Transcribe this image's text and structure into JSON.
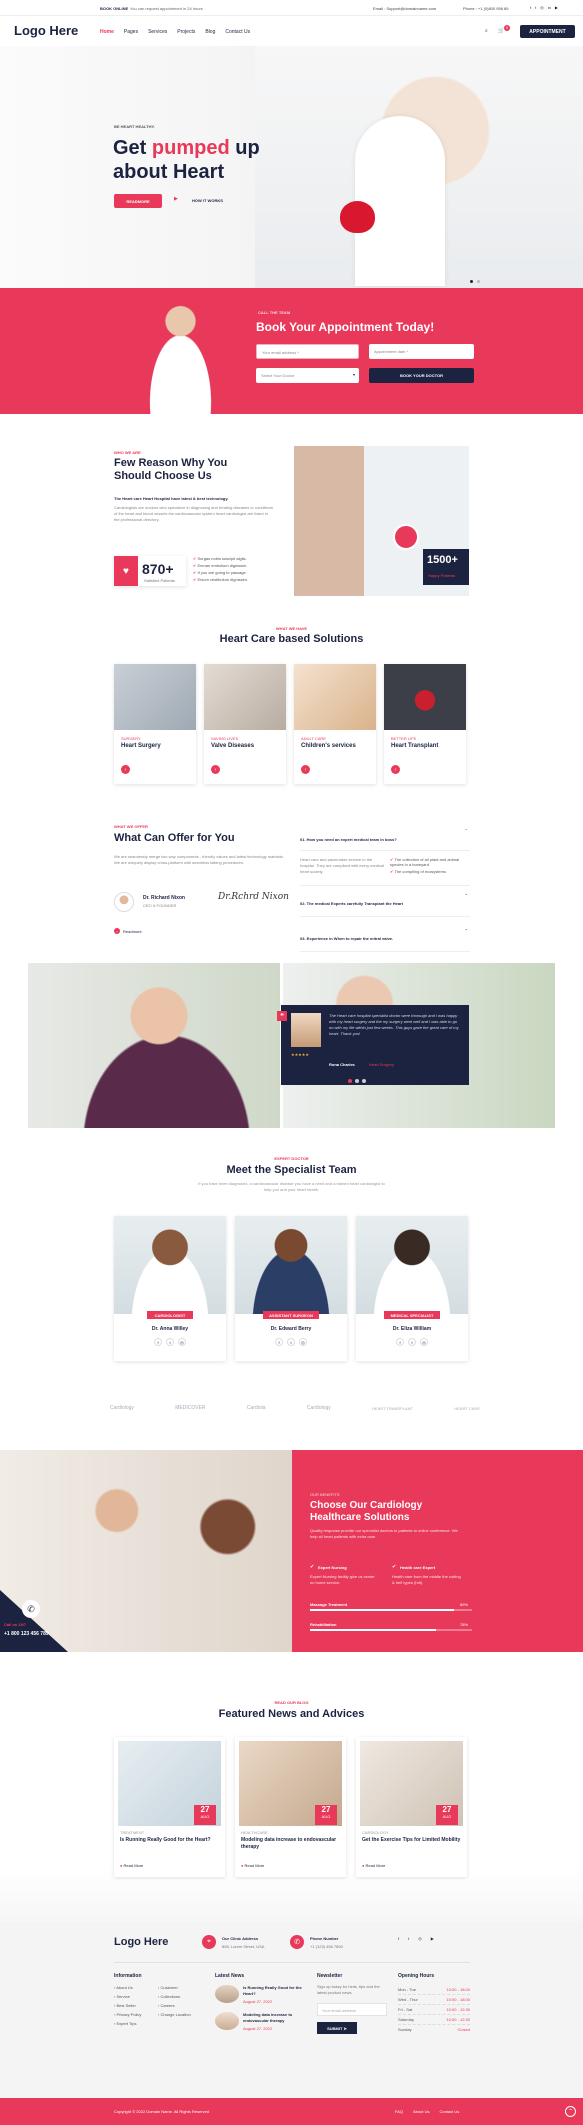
{
  "topbar": {
    "book": "BOOK ONLINE",
    "book_sub": "You can request appointment in 24 hours",
    "email": "Email : Support@domainname.com",
    "phone": "Phone : +1 (0)800 956 89"
  },
  "header": {
    "logo": "Logo Here",
    "nav": [
      "Home",
      "Pages",
      "Services",
      "Projects",
      "Blog",
      "Contact Us"
    ],
    "cart_count": "0",
    "appointment": "APPOINTMENT"
  },
  "hero": {
    "eyebrow": "BE HEART HEALTHY.",
    "title_a": "Get ",
    "title_b": "pumped",
    "title_c": " up",
    "title_d": "about Heart",
    "btn": "READMORE",
    "link": "HOW IT WORKS"
  },
  "booking": {
    "eyebrow": "CALL THE TEAM",
    "title": "Book Your Appointment Today!",
    "email_ph": "Your email address *",
    "date_ph": "Appointment date *",
    "doctor_ph": "Select Your Doctor",
    "btn": "BOOK YOUR DOCTOR"
  },
  "reason": {
    "eyebrow": "WHO WE ARE",
    "title": "Few Reason Why You Should Choose Us",
    "lead": "The Heart care Heart Hospital have latest & best technology.",
    "body": "Cardiologists are doctors who specialize in diagnosing and treating diseases or conditions of the heart and blood vessels the cardiovascular system heart cardiologist are listed in the professional directory.",
    "stat1": "870+",
    "stat1_label": "Satisfied Patients",
    "checks": [
      "Surgas nobis suscipit alglis.",
      "Enman embolium dignissim.",
      "If you are going to passage.",
      "Enium vestibulum dignissim."
    ],
    "stat2": "1500+",
    "stat2_label": "Happy Patients"
  },
  "solutions": {
    "eyebrow": "WHAT WE HAVE",
    "title": "Heart Care based Solutions",
    "items": [
      {
        "tag": "SURGERY",
        "name": "Heart Surgery"
      },
      {
        "tag": "SAVING LIVES",
        "name": "Valve Diseases"
      },
      {
        "tag": "ADULT CARE",
        "name": "Children's services"
      },
      {
        "tag": "BETTER LIFE",
        "name": "Heart Transplant"
      }
    ]
  },
  "offer": {
    "eyebrow": "WHAT WE OFFER",
    "title": "What Can Offer for You",
    "body": "We are seamlessly merge two way components - friendly values and latest technology maintain. We are uniquely display cross-platform with seamless talking procedures.",
    "doctor": "Dr. Richard Nixon",
    "doctor_role": "CEO & FOUNDER",
    "signature": "Dr.Rchrd Nixon",
    "badge": "Readmore",
    "faq": [
      {
        "q": "01. How you need an expert medical team in boss?",
        "a": "Heart care and pacemaker service to the hospital. They are compliant with every medical heart society.",
        "checks": [
          "The collection of all plant and animal species in a boneyard",
          "The compiling of ecosystems"
        ]
      },
      {
        "q": "02. The medical Experts carefully Transplant the Heart"
      },
      {
        "q": "03. Experience in When to repair the mitral valve."
      }
    ]
  },
  "testimonial": {
    "quote": "The Heart care hospital specialist doctor were thorough and I was happy with my heart surgery and the my surgery went well and I was able to go on with my life within just few weeks. This guys gave the great care of my heart. Thank you!",
    "author": "Rona Charles",
    "role": "Heart Surgery",
    "stars": "★★★★★",
    "quote_mark": "❝"
  },
  "team": {
    "eyebrow": "EXPERT DOCTOR",
    "title": "Meet the Specialist Team",
    "sub": "If you have been diagnosed, a cardiovascular disease you have a need and a trained heart cardiologist to help you and your heart health.",
    "members": [
      {
        "role": "CARDIOLOGIST",
        "name": "Dr. Anna Willey"
      },
      {
        "role": "ASSISTANT SURGEON",
        "name": "Dr. Edward Berry"
      },
      {
        "role": "MEDICAL SPECIALIST",
        "name": "Dr. Eliza William"
      }
    ]
  },
  "brands": [
    "Cardiology",
    "MEDICOVER",
    "Cardiola",
    "Cardiology",
    "HEART TRANSPLANT",
    "HEART CARE"
  ],
  "benefits": {
    "eyebrow": "OUR BENEFITS",
    "title": "Choose Our Cardiology Healthcare Solutions",
    "body": "Quality response provide our specialist doctors to patients to online conference. We help all heart patients with extra care.",
    "f1": "Expert Nursing",
    "f1_body": "Expert Nursing facility give us center on home service.",
    "f2": "Health care Expert",
    "f2_body": "Health care from the middle the cutting & helf types (hdt).",
    "bar1": "Massage Treatment",
    "bar1_val": "89%",
    "bar1_pct": 0.89,
    "bar2": "Rehabilitation",
    "bar2_val": "78%",
    "bar2_pct": 0.78,
    "call_label": "Call us 24/7",
    "call_number": "+1 800 123 456 789"
  },
  "blog": {
    "eyebrow": "READ OUR BLOG",
    "title": "Featured News and Advices",
    "posts": [
      {
        "day": "27",
        "mon": "AUG",
        "cat": "TREATMENT",
        "title": "Is Running Really Good for the Heart?",
        "more": "Read More"
      },
      {
        "day": "27",
        "mon": "AUG",
        "cat": "HEALTHCARE",
        "title": "Modeling data increase to endovascular therapy",
        "more": "Read More"
      },
      {
        "day": "27",
        "mon": "AUG",
        "cat": "CARDIOLOGY",
        "title": "Get the Exercise Tips for Limited Mobility",
        "more": "Read More"
      }
    ]
  },
  "footer": {
    "logo": "Logo Here",
    "addr_title": "Our Clinic Address",
    "addr": "898, Lorem Street, USA",
    "phone_title": "Phone Number",
    "phone": "+1 (123) 456 7890",
    "info_title": "Information",
    "info1": [
      "About Us",
      "Service",
      "Best Seller",
      "Privacy Policy",
      "Expert Tips"
    ],
    "info2": [
      "Customer",
      "Collections",
      "Careers",
      "Change Location"
    ],
    "news_title": "Latest News",
    "news": [
      {
        "t": "Is Running Really Good for the Heart?",
        "d": "August 27, 2022"
      },
      {
        "t": "Modeling data increase to endovascular therapy",
        "d": "August 27, 2022"
      }
    ],
    "newsletter_title": "Newsletter",
    "newsletter_body": "Sign up today for hints, tips and the latest product news.",
    "email_ph": "Your email address",
    "submit": "SUBMIT",
    "hours_title": "Opening Hours",
    "hours": [
      [
        "Mon - Tue",
        "10:00 - 18:00"
      ],
      [
        "Wed - Thur",
        "10:00 - 18:00"
      ],
      [
        "Fri - Sat",
        "10:00 - 12:30"
      ],
      [
        "Saturday",
        "10:00 - 12:30"
      ],
      [
        "Sunday",
        "Closed"
      ]
    ],
    "copyright": "Copyright © 2022 Domain Name. All Rights Reserved",
    "links": [
      "FAQ",
      "About Us",
      "Contact Us"
    ]
  }
}
